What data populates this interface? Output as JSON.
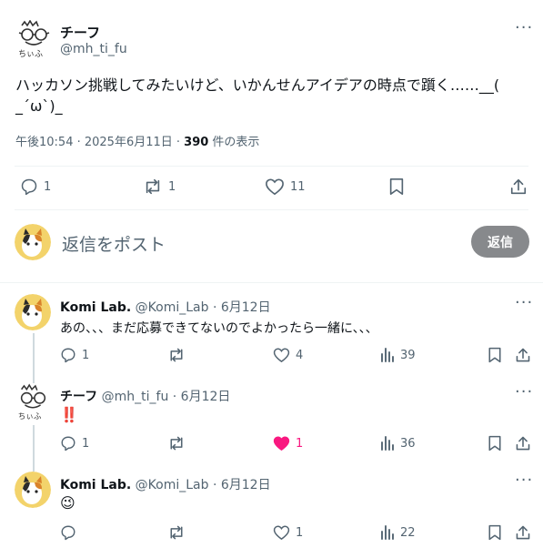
{
  "main_post": {
    "author_name": "チーフ",
    "handle": "@mh_ti_fu",
    "text_line1": "ハッカソン挑戦してみたいけど、いかんせんアイデアの時点で躓く……__(",
    "text_line2": "_´ω`)_",
    "time": "午後10:54 · 2025年6月11日 · ",
    "views": "390",
    "views_label": " 件の表示",
    "replies": "1",
    "reposts": "1",
    "likes": "11"
  },
  "compose": {
    "placeholder": "返信をポスト",
    "button": "返信"
  },
  "replies": [
    {
      "author_name": "Komi Lab.",
      "handle": "@Komi_Lab",
      "date": " · 6月12日",
      "text": "あの、、、まだ応募できてないのでよかったら一緒に、、、",
      "replies": "1",
      "reposts": "",
      "likes": "4",
      "views": "39",
      "liked": false
    },
    {
      "author_name": "チーフ",
      "handle": "@mh_ti_fu",
      "date": " · 6月12日",
      "text": "‼️",
      "replies": "1",
      "reposts": "",
      "likes": "1",
      "views": "36",
      "liked": true
    },
    {
      "author_name": "Komi Lab.",
      "handle": "@Komi_Lab",
      "date": " · 6月12日",
      "text": "😉",
      "replies": "",
      "reposts": "",
      "likes": "1",
      "views": "22",
      "liked": false
    }
  ],
  "colors": {
    "like_active": "#f91880",
    "button_bg": "#87898c",
    "border": "#eff3f4"
  },
  "icons": {
    "reply": "speech-bubble-icon",
    "repost": "repost-arrows-icon",
    "like": "heart-icon",
    "views": "bar-chart-icon",
    "bookmark": "bookmark-icon",
    "share": "upload-icon",
    "more": "more-dots-icon"
  }
}
